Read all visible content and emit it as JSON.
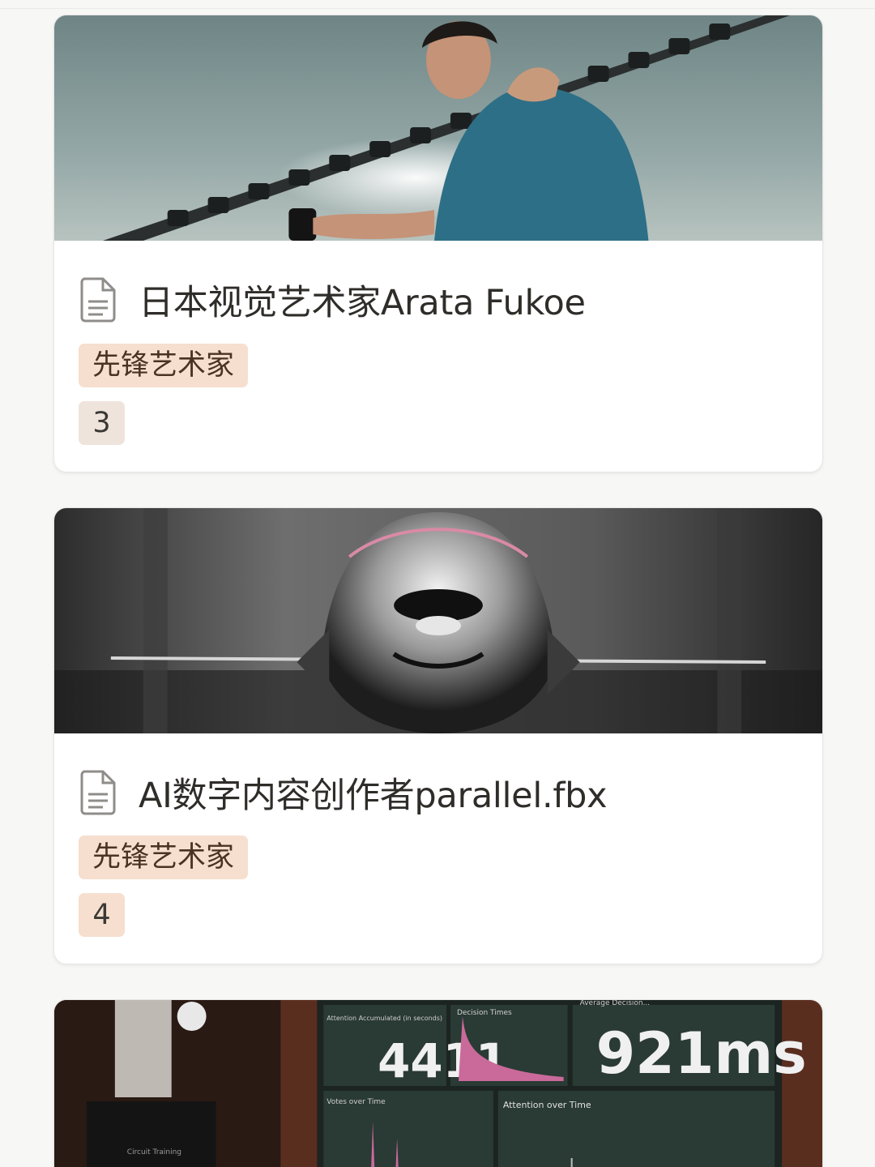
{
  "cards": [
    {
      "title": "日本视觉艺术家Arata Fukoe",
      "tag": "先锋艺术家",
      "number": "3",
      "cover_icon": "person-with-camera-rig-photo"
    },
    {
      "title": "AI数字内容创作者parallel.fbx",
      "tag": "先锋艺术家",
      "number": "4",
      "cover_icon": "chrome-robot-head-photo"
    },
    {
      "cover_icon": "data-dashboard-photo",
      "dashboard": {
        "panel1_label": "Attention Accumulated (in seconds)",
        "panel1_value": "4411",
        "panel2_label": "Decision Times",
        "panel3_label": "Average Decision...",
        "panel3_value": "921ms",
        "panel4_label": "Votes over Time",
        "panel5_label": "Attention over Time",
        "side_label": "Circuit Training"
      }
    }
  ],
  "colors": {
    "tag_bg": "#f6dfcf",
    "number_badge_bg": "#efe4dc",
    "card_bg": "#ffffff",
    "page_bg": "#f7f7f5"
  }
}
